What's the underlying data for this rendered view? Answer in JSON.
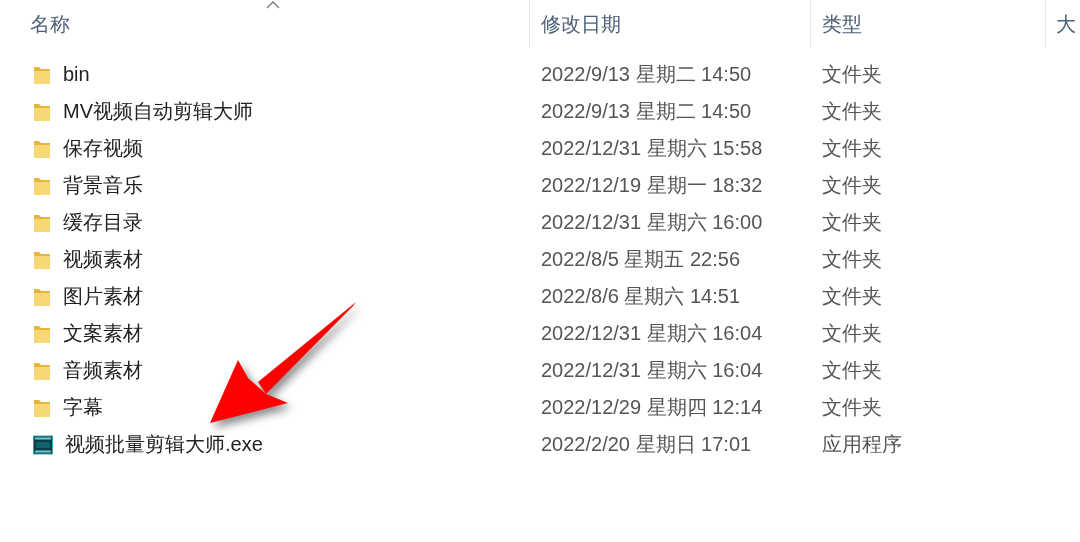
{
  "columns": [
    {
      "label": "名称",
      "sorted": true
    },
    {
      "label": "修改日期",
      "sorted": false
    },
    {
      "label": "类型",
      "sorted": false
    },
    {
      "label": "大",
      "sorted": false
    }
  ],
  "rows": [
    {
      "kind": "folder",
      "name": "bin",
      "modified": "2022/9/13 星期二 14:50",
      "type": "文件夹"
    },
    {
      "kind": "folder",
      "name": "MV视频自动剪辑大师",
      "modified": "2022/9/13 星期二 14:50",
      "type": "文件夹"
    },
    {
      "kind": "folder",
      "name": "保存视频",
      "modified": "2022/12/31 星期六 15:58",
      "type": "文件夹"
    },
    {
      "kind": "folder",
      "name": "背景音乐",
      "modified": "2022/12/19 星期一 18:32",
      "type": "文件夹"
    },
    {
      "kind": "folder",
      "name": "缓存目录",
      "modified": "2022/12/31 星期六 16:00",
      "type": "文件夹"
    },
    {
      "kind": "folder",
      "name": "视频素材",
      "modified": "2022/8/5 星期五 22:56",
      "type": "文件夹"
    },
    {
      "kind": "folder",
      "name": "图片素材",
      "modified": "2022/8/6 星期六 14:51",
      "type": "文件夹"
    },
    {
      "kind": "folder",
      "name": "文案素材",
      "modified": "2022/12/31 星期六 16:04",
      "type": "文件夹"
    },
    {
      "kind": "folder",
      "name": "音频素材",
      "modified": "2022/12/31 星期六 16:04",
      "type": "文件夹"
    },
    {
      "kind": "folder",
      "name": "字幕",
      "modified": "2022/12/29 星期四 12:14",
      "type": "文件夹"
    },
    {
      "kind": "application",
      "name": "视频批量剪辑大师.exe",
      "modified": "2022/2/20 星期日 17:01",
      "type": "应用程序"
    }
  ]
}
